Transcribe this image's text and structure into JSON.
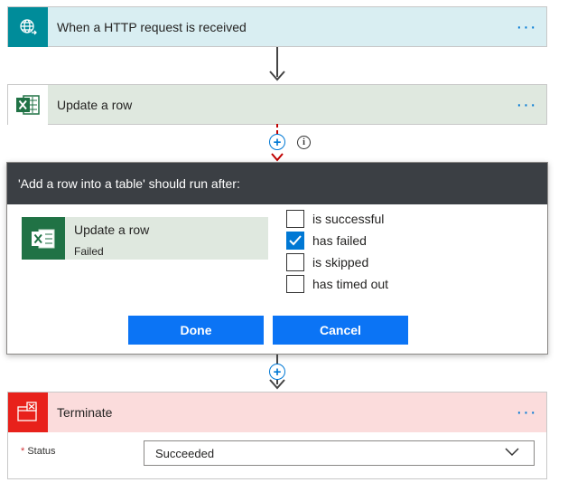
{
  "trigger": {
    "title": "When a HTTP request is received",
    "menu": "···"
  },
  "update_action": {
    "title": "Update a row",
    "menu": "···"
  },
  "run_after": {
    "header": "'Add a row into a table' should run after:",
    "action_name": "Update a row",
    "action_status": "Failed",
    "options": [
      {
        "label": "is successful",
        "checked": false
      },
      {
        "label": "has failed",
        "checked": true
      },
      {
        "label": "is skipped",
        "checked": false
      },
      {
        "label": "has timed out",
        "checked": false
      }
    ],
    "done_label": "Done",
    "cancel_label": "Cancel"
  },
  "terminate": {
    "title": "Terminate",
    "menu": "···",
    "status_required": "*",
    "status_label": "Status",
    "status_value": "Succeeded"
  },
  "colors": {
    "accent": "#0078d4",
    "button": "#0b74f5",
    "excel": "#207245",
    "trigger_icon": "#008c9a",
    "terminate_icon": "#e8211b"
  },
  "icons": [
    "globe-request-icon",
    "excel-icon",
    "add-step-icon",
    "info-icon",
    "terminate-icon",
    "checkmark-icon",
    "chevron-down-icon"
  ]
}
